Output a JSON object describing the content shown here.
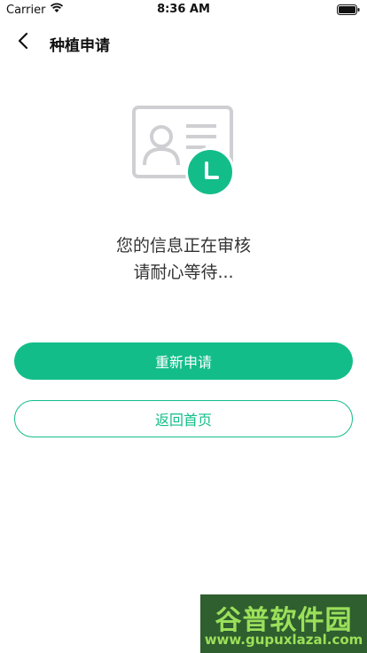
{
  "status_bar": {
    "carrier": "Carrier",
    "time": "8:36 AM",
    "wifi_icon": "wifi-icon",
    "battery_icon": "battery-icon"
  },
  "nav": {
    "back_icon": "chevron-left-icon",
    "title": "种植申请"
  },
  "illustration": {
    "icon": "id-card-pending-icon",
    "accent_color": "#13bd89",
    "card_color": "#cfcfd3"
  },
  "message": {
    "line1": "您的信息正在审核",
    "line2": "请耐心等待..."
  },
  "buttons": {
    "reapply_label": "重新申请",
    "home_label": "返回首页"
  },
  "watermark": {
    "title": "谷普软件园",
    "url": "www.gupuxlazal.com"
  },
  "colors": {
    "primary": "#13bd89",
    "text": "#333333"
  }
}
